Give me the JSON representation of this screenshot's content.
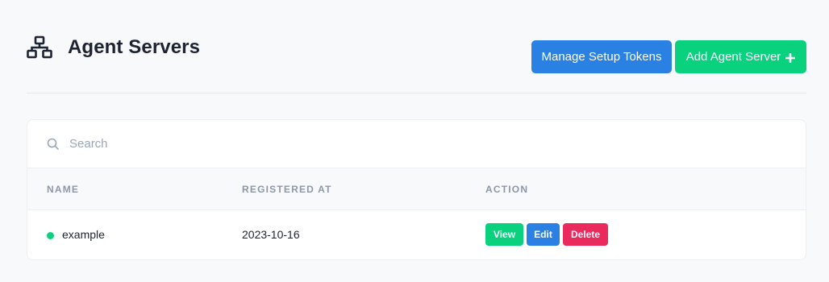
{
  "header": {
    "title": "Agent Servers",
    "icon": "network-icon",
    "manage_tokens_label": "Manage Setup Tokens",
    "add_server_label": "Add Agent Server"
  },
  "search": {
    "placeholder": "Search",
    "value": ""
  },
  "table": {
    "columns": [
      "NAME",
      "REGISTERED AT",
      "ACTION"
    ],
    "rows": [
      {
        "name": "example",
        "status": "online",
        "registered_at": "2023-10-16",
        "actions": [
          "View",
          "Edit",
          "Delete"
        ]
      }
    ]
  },
  "colors": {
    "primary": "#2a80e3",
    "success": "#09d17e",
    "danger": "#ea2a5d",
    "background": "#f8f9fb"
  }
}
